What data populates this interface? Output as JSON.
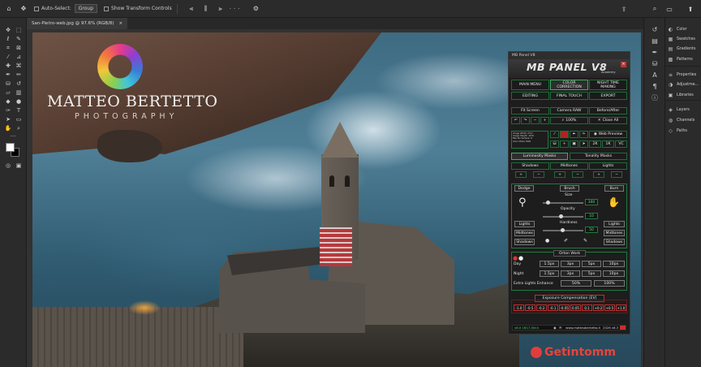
{
  "options_bar": {
    "auto_select_label": "Auto-Select:",
    "auto_select_value": "Group",
    "show_transform_label": "Show Transform Controls"
  },
  "document_tab": {
    "label": "San-Pietro-web.jpg @ 97.6% (RGB/8)"
  },
  "canvas": {
    "logo_name": "MATTEO BERTETTO",
    "logo_sub": "PHOTOGRAPHY",
    "watermark": "Getintomm"
  },
  "right_panels": [
    {
      "icon": "color-icon",
      "glyph": "◐",
      "label": "Color"
    },
    {
      "icon": "swatches-icon",
      "glyph": "▦",
      "label": "Swatches"
    },
    {
      "icon": "gradients-icon",
      "glyph": "▤",
      "label": "Gradients"
    },
    {
      "icon": "patterns-icon",
      "glyph": "▩",
      "label": "Patterns"
    },
    {
      "icon": "properties-icon",
      "glyph": "≡",
      "label": "Properties"
    },
    {
      "icon": "adjustments-icon",
      "glyph": "◑",
      "label": "Adjustme..."
    },
    {
      "icon": "libraries-icon",
      "glyph": "▣",
      "label": "Libraries"
    },
    {
      "icon": "layers-icon",
      "glyph": "◈",
      "label": "Layers"
    },
    {
      "icon": "channels-icon",
      "glyph": "◍",
      "label": "Channels"
    },
    {
      "icon": "paths-icon",
      "glyph": "◇",
      "label": "Paths"
    }
  ],
  "mb_panel": {
    "window_title": "MB Panel V8",
    "brand": "MB PANEL V8",
    "academy": "Academy",
    "nav": {
      "main_menu": "MAIN MENU",
      "color_correction": "COLOR CORRECTION",
      "night_time": "NIGHT TIME MAKING",
      "editing": "EDITING",
      "final_touch": "FINAL TOUCH",
      "export": "EXPORT"
    },
    "view": {
      "fit_screen": "Fit Screen",
      "camera_raw": "Camera RAW",
      "before_after": "Before/After",
      "zoom": "100%",
      "close_all": "Close All"
    },
    "web_preview": "Web Preview",
    "size_2k": "2K",
    "size_1k": "1K",
    "vc": "VC",
    "image_info": [
      "Image Width: 2517",
      "Image Height: 1678",
      "Bits Per Sample: 8",
      "Color Mode: RGB"
    ],
    "luminosity_masks": "Luminosity Masks",
    "tonality_masks": "Tonality Masks",
    "masks": {
      "shadows": "Shadows",
      "midtones": "Midtones",
      "lights": "Lights"
    },
    "brush": {
      "dodge": "Dodge",
      "brush": "Brush",
      "burn": "Burn",
      "size_label": "Size",
      "size_value": "300",
      "opacity_label": "Opacity",
      "opacity_value": "10",
      "hardness_label": "Hardness",
      "hardness_value": "50",
      "lights": "Lights",
      "midtones": "Midtones",
      "shadows": "Shadows",
      "lights_r": "Lights",
      "midtones_r": "Midtones",
      "shadows_r": "Shadows"
    },
    "orton": {
      "title": "Orton Work",
      "day": "Day",
      "night": "Night",
      "day_values": [
        "1.5px",
        "3px",
        "5px",
        "10px"
      ],
      "night_values": [
        "1.5px",
        "3px",
        "5px",
        "10px"
      ],
      "extra_lights": "Extra Lights Enhance",
      "pct_50": "50%",
      "pct_100": "100%"
    },
    "exposure": {
      "title": "Exposure Compensation (EV)",
      "values": [
        "-1.0",
        "-0.5",
        "-0.2",
        "-0.1",
        "-0.05",
        "0.05",
        "0.1",
        "+0.2",
        "+0.5",
        "+1.0"
      ]
    },
    "footer": {
      "green_text": "v8.0 1617-00c4",
      "url": "www.matteobertetto.it",
      "version": "2026 v8.3"
    }
  }
}
